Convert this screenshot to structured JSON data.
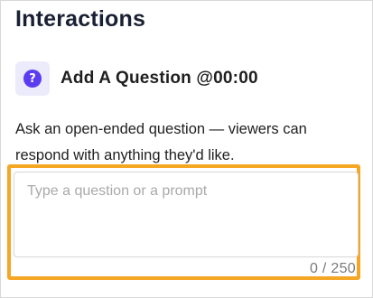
{
  "panel": {
    "title": "Interactions"
  },
  "question": {
    "icon": "question-circle-icon",
    "label": "Add A Question @00:00"
  },
  "description": "Ask an open-ended question — viewers can respond with anything they'd like.",
  "input": {
    "placeholder": "Type a question or a prompt",
    "value": "",
    "counter": "0 / 250"
  },
  "colors": {
    "accent": "#5b3cf0",
    "highlight": "#f5a623",
    "title": "#1a2033"
  }
}
